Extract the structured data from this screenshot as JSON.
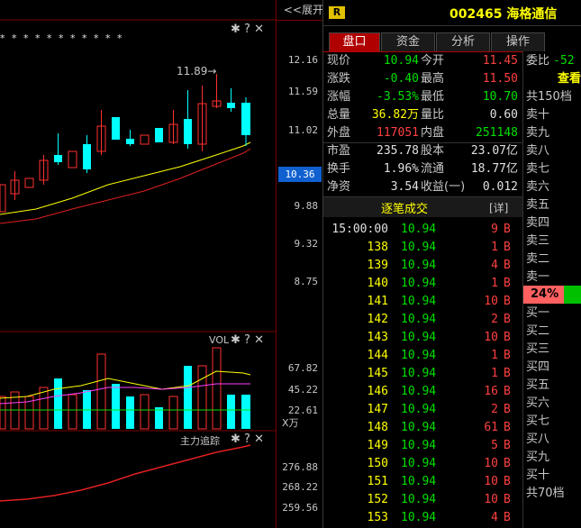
{
  "toolbar": {
    "expand_label": "<<展开"
  },
  "axis": {
    "price_ticks": [
      "12.16",
      "11.59",
      "11.02",
      "10.36",
      "9.88",
      "9.32",
      "8.75"
    ],
    "current_marker": "10.36",
    "vol_ticks": [
      "67.82",
      "45.22",
      "22.61"
    ],
    "vol_unit": "X万",
    "tracker_ticks": [
      "276.88",
      "268.22",
      "259.56"
    ]
  },
  "main_chart": {
    "high_label": "11.89→",
    "star_row": "*  *  *  *  *  *  *  *     *  *     *"
  },
  "vol_panel": {
    "title": "VOL"
  },
  "tracker_panel": {
    "title": "主力追踪"
  },
  "stock": {
    "badge": "R",
    "code": "002465",
    "name": "海格通信"
  },
  "tabs": [
    {
      "label": "盘口",
      "active": true
    },
    {
      "label": "资金",
      "active": false
    },
    {
      "label": "分析",
      "active": false
    },
    {
      "label": "操作",
      "active": false
    }
  ],
  "quote": {
    "xianjia_l": "现价",
    "xianjia": "10.94",
    "jinkai_l": "今开",
    "jinkai": "11.45",
    "zhangdie_l": "涨跌",
    "zhangdie": "-0.40",
    "zuigao_l": "最高",
    "zuigao": "11.50",
    "zhangfu_l": "涨幅",
    "zhangfu": "-3.53%",
    "zuidi_l": "最低",
    "zuidi": "10.70",
    "zongliang_l": "总量",
    "zongliang": "36.82万",
    "liangbi_l": "量比",
    "liangbi": "0.60",
    "waipan_l": "外盘",
    "waipan": "117051",
    "neipan_l": "内盘",
    "neipan": "251148",
    "shiying_l": "市盈",
    "shiying": "235.78",
    "guben_l": "股本",
    "guben": "23.07亿",
    "huanshou_l": "换手",
    "huanshou": "1.96%",
    "liutong_l": "流通",
    "liutong": "18.77亿",
    "jingzi_l": "净资",
    "jingzi": "3.54",
    "shouyi_l": "收益(一)",
    "shouyi": "0.012"
  },
  "trades_header": {
    "title": "逐笔成交",
    "detail": "[详]"
  },
  "trades": [
    {
      "t": "15:00:00",
      "p": "10.94",
      "v": "9",
      "s": "B"
    },
    {
      "t": "138",
      "p": "10.94",
      "v": "1",
      "s": "B"
    },
    {
      "t": "139",
      "p": "10.94",
      "v": "4",
      "s": "B"
    },
    {
      "t": "140",
      "p": "10.94",
      "v": "1",
      "s": "B"
    },
    {
      "t": "141",
      "p": "10.94",
      "v": "10",
      "s": "B"
    },
    {
      "t": "142",
      "p": "10.94",
      "v": "2",
      "s": "B"
    },
    {
      "t": "143",
      "p": "10.94",
      "v": "10",
      "s": "B"
    },
    {
      "t": "144",
      "p": "10.94",
      "v": "1",
      "s": "B"
    },
    {
      "t": "145",
      "p": "10.94",
      "v": "1",
      "s": "B"
    },
    {
      "t": "146",
      "p": "10.94",
      "v": "16",
      "s": "B"
    },
    {
      "t": "147",
      "p": "10.94",
      "v": "2",
      "s": "B"
    },
    {
      "t": "148",
      "p": "10.94",
      "v": "61",
      "s": "B"
    },
    {
      "t": "149",
      "p": "10.94",
      "v": "5",
      "s": "B"
    },
    {
      "t": "150",
      "p": "10.94",
      "v": "10",
      "s": "B"
    },
    {
      "t": "151",
      "p": "10.94",
      "v": "10",
      "s": "B"
    },
    {
      "t": "152",
      "p": "10.94",
      "v": "10",
      "s": "B"
    },
    {
      "t": "153",
      "p": "10.94",
      "v": "4",
      "s": "B"
    }
  ],
  "orderbook": {
    "weibi_l": "委比",
    "weibi": "-52",
    "chaxun": "查看",
    "sell_total": "共150档",
    "sells": [
      "卖十",
      "卖九",
      "卖八",
      "卖七",
      "卖六",
      "卖五",
      "卖四",
      "卖三",
      "卖二",
      "卖一"
    ],
    "pct": "24%",
    "buys": [
      "买一",
      "买二",
      "买三",
      "买四",
      "买五",
      "买六",
      "买七",
      "买八",
      "买九",
      "买十"
    ],
    "buy_total": "共70档"
  },
  "colors": {
    "up": "#ff4040",
    "down": "#00ffff",
    "accent_red": "#b00000",
    "blue_marker": "#1060d0"
  }
}
